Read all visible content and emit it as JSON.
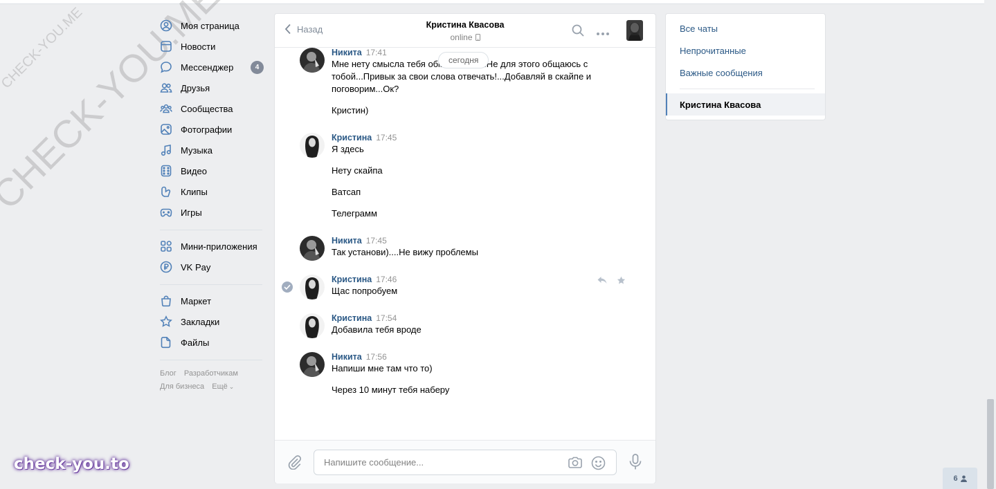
{
  "watermark": {
    "small": "CHECK-YOU.ME",
    "big": "CHECK-YOU.ME",
    "tag": "check-you.to"
  },
  "nav": {
    "items": [
      {
        "label": "Моя страница",
        "icon": "user-circle-icon"
      },
      {
        "label": "Новости",
        "icon": "news-icon"
      },
      {
        "label": "Мессенджер",
        "icon": "chat-icon",
        "badge": "4"
      },
      {
        "label": "Друзья",
        "icon": "friends-icon"
      },
      {
        "label": "Сообщества",
        "icon": "groups-icon"
      },
      {
        "label": "Фотографии",
        "icon": "photo-icon"
      },
      {
        "label": "Музыка",
        "icon": "music-icon"
      },
      {
        "label": "Видео",
        "icon": "video-icon"
      },
      {
        "label": "Клипы",
        "icon": "clips-icon"
      },
      {
        "label": "Игры",
        "icon": "gamepad-icon"
      }
    ],
    "items2": [
      {
        "label": "Мини-приложения",
        "icon": "apps-icon"
      },
      {
        "label": "VK Pay",
        "icon": "vkpay-icon"
      }
    ],
    "items3": [
      {
        "label": "Маркет",
        "icon": "market-bag-icon"
      },
      {
        "label": "Закладки",
        "icon": "star-icon"
      },
      {
        "label": "Файлы",
        "icon": "file-icon"
      }
    ],
    "footer": {
      "blog": "Блог",
      "developers": "Разработчикам",
      "business": "Для бизнеса",
      "more": "Ещё"
    }
  },
  "chat": {
    "back": "Назад",
    "peer_name": "Кристина Квасова",
    "peer_status": "online",
    "date_pill": "сегодня",
    "messages": [
      {
        "author": "Никита",
        "time": "17:41",
        "lines": [
          "Мне нету смысла тебя обманывать...Не для этого общаюсь с",
          "тобой...Привык за свои слова отвечать!...Добавляй в скайпе и",
          "поговорим...Ок?"
        ],
        "extra": [
          "Кристин)"
        ]
      },
      {
        "author": "Кристина",
        "time": "17:45",
        "lines": [
          "Я здесь"
        ],
        "extra": [
          "Нету скайпа",
          "Ватсап",
          "Телеграмм"
        ]
      },
      {
        "author": "Никита",
        "time": "17:45",
        "lines": [
          "Так установи)....Не вижу проблемы"
        ],
        "extra": []
      },
      {
        "author": "Кристина",
        "time": "17:46",
        "lines": [
          "Щас попробуем"
        ],
        "extra": []
      },
      {
        "author": "Кристина",
        "time": "17:54",
        "lines": [
          "Добавила тебя вроде"
        ],
        "extra": []
      },
      {
        "author": "Никита",
        "time": "17:56",
        "lines": [
          "Напиши мне там что то)"
        ],
        "extra": [
          "Через 10 минут тебя наберу"
        ]
      }
    ],
    "composer_placeholder": "Напишите сообщение..."
  },
  "filters": {
    "all": "Все чаты",
    "unread": "Непрочитанные",
    "important": "Важные сообщения",
    "active_chat": "Кристина Квасова"
  },
  "online_count": "6",
  "colors": {
    "link": "#2a5885",
    "accent": "#5181b8",
    "bg": "#edeef0"
  }
}
